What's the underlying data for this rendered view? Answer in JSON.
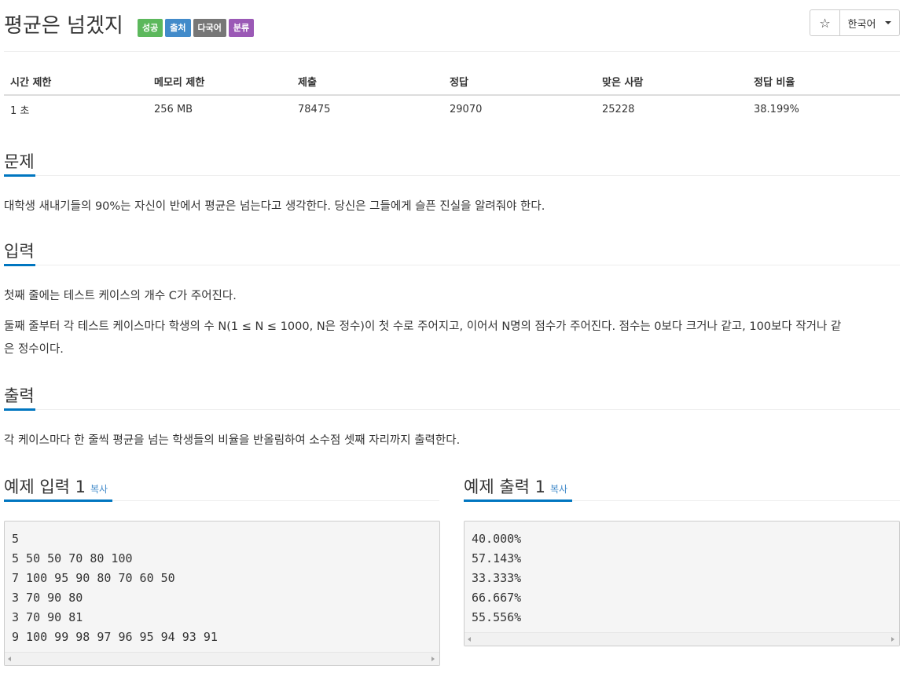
{
  "header": {
    "title": "평균은 넘겠지",
    "labels": [
      "성공",
      "출처",
      "다국어",
      "분류"
    ],
    "star_icon": "☆",
    "language": "한국어"
  },
  "info_table": {
    "headers": [
      "시간 제한",
      "메모리 제한",
      "제출",
      "정답",
      "맞은 사람",
      "정답 비율"
    ],
    "values": [
      "1 초",
      "256 MB",
      "78475",
      "29070",
      "25228",
      "38.199%"
    ]
  },
  "problem": {
    "title": "문제",
    "text": "대학생 새내기들의 90%는 자신이 반에서 평균은 넘는다고 생각한다. 당신은 그들에게 슬픈 진실을 알려줘야 한다."
  },
  "input": {
    "title": "입력",
    "line1": "첫째 줄에는 테스트 케이스의 개수 C가 주어진다.",
    "line2a": "둘째 줄부터 각 테스트 케이스마다 학생의 수 N(1 ≤ N ≤ 1000, N은 정수)이 첫 수로 주어지고, 이어서 N명의 점수가 주어진다. 점수는 0보다 크거나 같고, 100보다 작거나 같",
    "line2b": "은 정수이다."
  },
  "output": {
    "title": "출력",
    "text": "각 케이스마다 한 줄씩 평균을 넘는 학생들의 비율을 반올림하여 소수점 셋째 자리까지 출력한다."
  },
  "sample_input": {
    "title": "예제 입력 1",
    "copy": "복사",
    "lines": [
      "5",
      "5 50 50 70 80 100",
      "7 100 95 90 80 70 60 50",
      "3 70 90 80",
      "3 70 90 81",
      "9 100 99 98 97 96 95 94 93 91"
    ]
  },
  "sample_output": {
    "title": "예제 출력 1",
    "copy": "복사",
    "lines": [
      "40.000%",
      "57.143%",
      "33.333%",
      "66.667%",
      "55.556%"
    ]
  },
  "colors": {
    "label_success": "#5cb85c",
    "label_primary": "#428bca",
    "label_default": "#777777",
    "label_purple": "#9b59b6",
    "accent": "#0076c0"
  }
}
